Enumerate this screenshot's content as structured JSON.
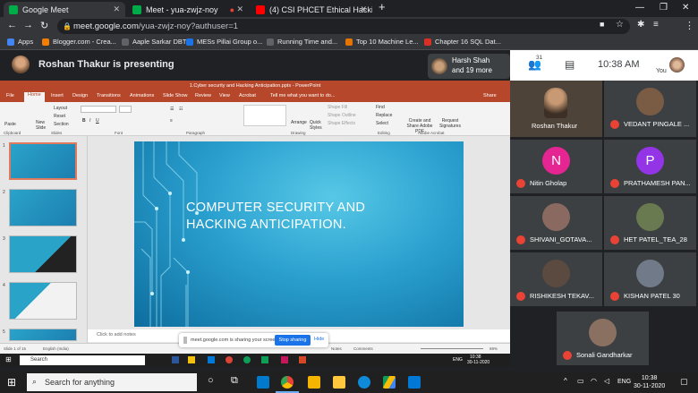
{
  "browser": {
    "tabs": [
      {
        "label": "Google Meet",
        "active": true
      },
      {
        "label": "Meet - yua-zwjz-noy",
        "active": false
      },
      {
        "label": "(4) CSI PHCET Ethical Hacking W",
        "active": false
      }
    ],
    "url_host": "meet.google.com",
    "url_path": "/yua-zwjz-noy?authuser=1",
    "bookmarks": [
      "Apps",
      "Blogger.com - Crea...",
      "Aaple Sarkar DBT",
      "MESs Pillai Group o...",
      "Running Time and...",
      "Top 10 Machine Le...",
      "Chapter 16 SQL Dat..."
    ]
  },
  "meet": {
    "presenting_text": "Roshan Thakur is presenting",
    "others_name": "Harsh Shah",
    "others_more": "and 19 more",
    "participant_count": "31",
    "clock": "10:38 AM",
    "you_label": "You",
    "participants": [
      {
        "name": "Roshan Thakur",
        "initial": "",
        "color": "#6b5a4a",
        "muted": false
      },
      {
        "name": "VEDANT PINGALE ...",
        "initial": "",
        "color": "#7a5b44",
        "muted": true
      },
      {
        "name": "Nitin Gholap",
        "initial": "N",
        "color": "#e52592",
        "muted": true
      },
      {
        "name": "PRATHAMESH PAN...",
        "initial": "P",
        "color": "#9334e6",
        "muted": true
      },
      {
        "name": "SHIVANI_GOTAVA...",
        "initial": "",
        "color": "#8a6a60",
        "muted": true
      },
      {
        "name": "HET PATEL_TEA_28",
        "initial": "",
        "color": "#6a7a50",
        "muted": true
      },
      {
        "name": "RISHIKESH TEKAV...",
        "initial": "",
        "color": "#5a4a40",
        "muted": true
      },
      {
        "name": "KISHAN PATEL 30",
        "initial": "",
        "color": "#707a88",
        "muted": true
      },
      {
        "name": "Sonali Gandharkar",
        "initial": "",
        "color": "#8a7060",
        "muted": true
      }
    ]
  },
  "ppt": {
    "title": "1.Cyber security and Hacking Anticipation.pptx - PowerPoint",
    "tabs": [
      "File",
      "Home",
      "Insert",
      "Design",
      "Transitions",
      "Animations",
      "Slide Show",
      "Review",
      "View",
      "Acrobat",
      "Tell me what you want to do..."
    ],
    "share_label": "Share",
    "groups": [
      "Clipboard",
      "Slides",
      "Font",
      "Paragraph",
      "Drawing",
      "Editing",
      "Adobe Acrobat"
    ],
    "ribbon_buttons": [
      "Paste",
      "New Slide",
      "Layout",
      "Reset",
      "Section",
      "Arrange",
      "Quick Styles",
      "Shape Fill",
      "Shape Outline",
      "Shape Effects",
      "Find",
      "Replace",
      "Select",
      "Create and Share Adobe PDF",
      "Request Signatures"
    ],
    "thumb_numbers": [
      "1",
      "2",
      "3",
      "4",
      "5"
    ],
    "slide_title": "COMPUTER SECURITY AND HACKING ANTICIPATION.",
    "notes_placeholder": "Click to add notes",
    "status_left": "Slide 1 of 15",
    "status_lang": "English (India)",
    "status_notes": "Notes",
    "status_comments": "Comments",
    "zoom": "69%",
    "share_notice": "meet.google.com is sharing your screen.",
    "stop_label": "Stop sharing",
    "hide_label": "Hide",
    "inner_search": "Search",
    "inner_lang": "ENG",
    "inner_time": "10:38",
    "inner_date": "30-11-2020"
  },
  "taskbar": {
    "search_placeholder": "Search for anything",
    "lang": "ENG",
    "time": "10:38",
    "date": "30-11-2020"
  }
}
